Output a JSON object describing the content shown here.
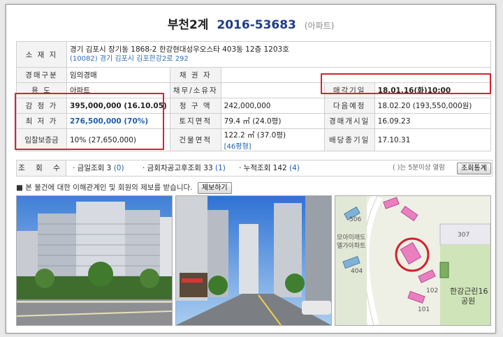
{
  "header": {
    "court": "부천2계",
    "case_no": "2016-53683",
    "kind": "(아파트)"
  },
  "info": {
    "location_label": "소 재 지",
    "address_line1": "경기 김포시 장기동 1868-2 한강현대성우오스타 403동 12층 1203호",
    "address_line2": "(10082) 경기 김포시 김포한강2로 292",
    "auction_type_label": "경매구분",
    "auction_type": "임의경매",
    "creditor_label": "채 권 자",
    "creditor": "",
    "usage_label": "용 도",
    "usage": "아파트",
    "debtor_label": "채무/소유자",
    "debtor": "",
    "sale_date_label": "매각기일",
    "sale_date": "18.01.16(화)10:00",
    "appraisal_label": "감 정 가",
    "appraisal": "395,000,000 (16.10.05)",
    "claim_label": "청 구 액",
    "claim": "242,000,000",
    "next_label": "다음예정",
    "next": "18.02.20 (193,550,000원)",
    "min_label": "최 저 가",
    "min": "276,500,000 (70%)",
    "land_label": "토지면적",
    "land": "79.4 ㎡ (24.0평)",
    "start_label": "경매개시일",
    "start": "16.09.23",
    "deposit_label": "입찰보증금",
    "deposit": "10% (27,650,000)",
    "bldg_label": "건물면적",
    "bldg": "122.2 ㎡ (37.0평)",
    "bldg_size": "[46평형]",
    "dividend_label": "배당종기일",
    "dividend": "17.10.31"
  },
  "stats": {
    "label": "조 회 수",
    "today_text": "· 금일조회 3",
    "today_paren": "(0)",
    "recent_text": "· 금회차공고후조회 33",
    "recent_paren": "(1)",
    "total_text": "· 누적조회 142",
    "total_paren": "(4)",
    "note": "( )는 5분이상 열람",
    "button": "조회통계"
  },
  "notice": {
    "text": "■ 본 물건에 대한 이해관계인 및 회원의 제보를 받습니다.",
    "button": "제보하기"
  },
  "map": {
    "label_complex": "모아미래도",
    "label_complex2": "엘가아파트",
    "label_park": "한강근린16",
    "label_park2": "공원",
    "label_307": "307",
    "label_101": "101",
    "label_102": "102",
    "label_404": "404",
    "label_506": "506"
  },
  "colors": {
    "accent_red": "#d4232f",
    "case_blue": "#1f3b8a",
    "value_blue": "#1c5fb0"
  }
}
